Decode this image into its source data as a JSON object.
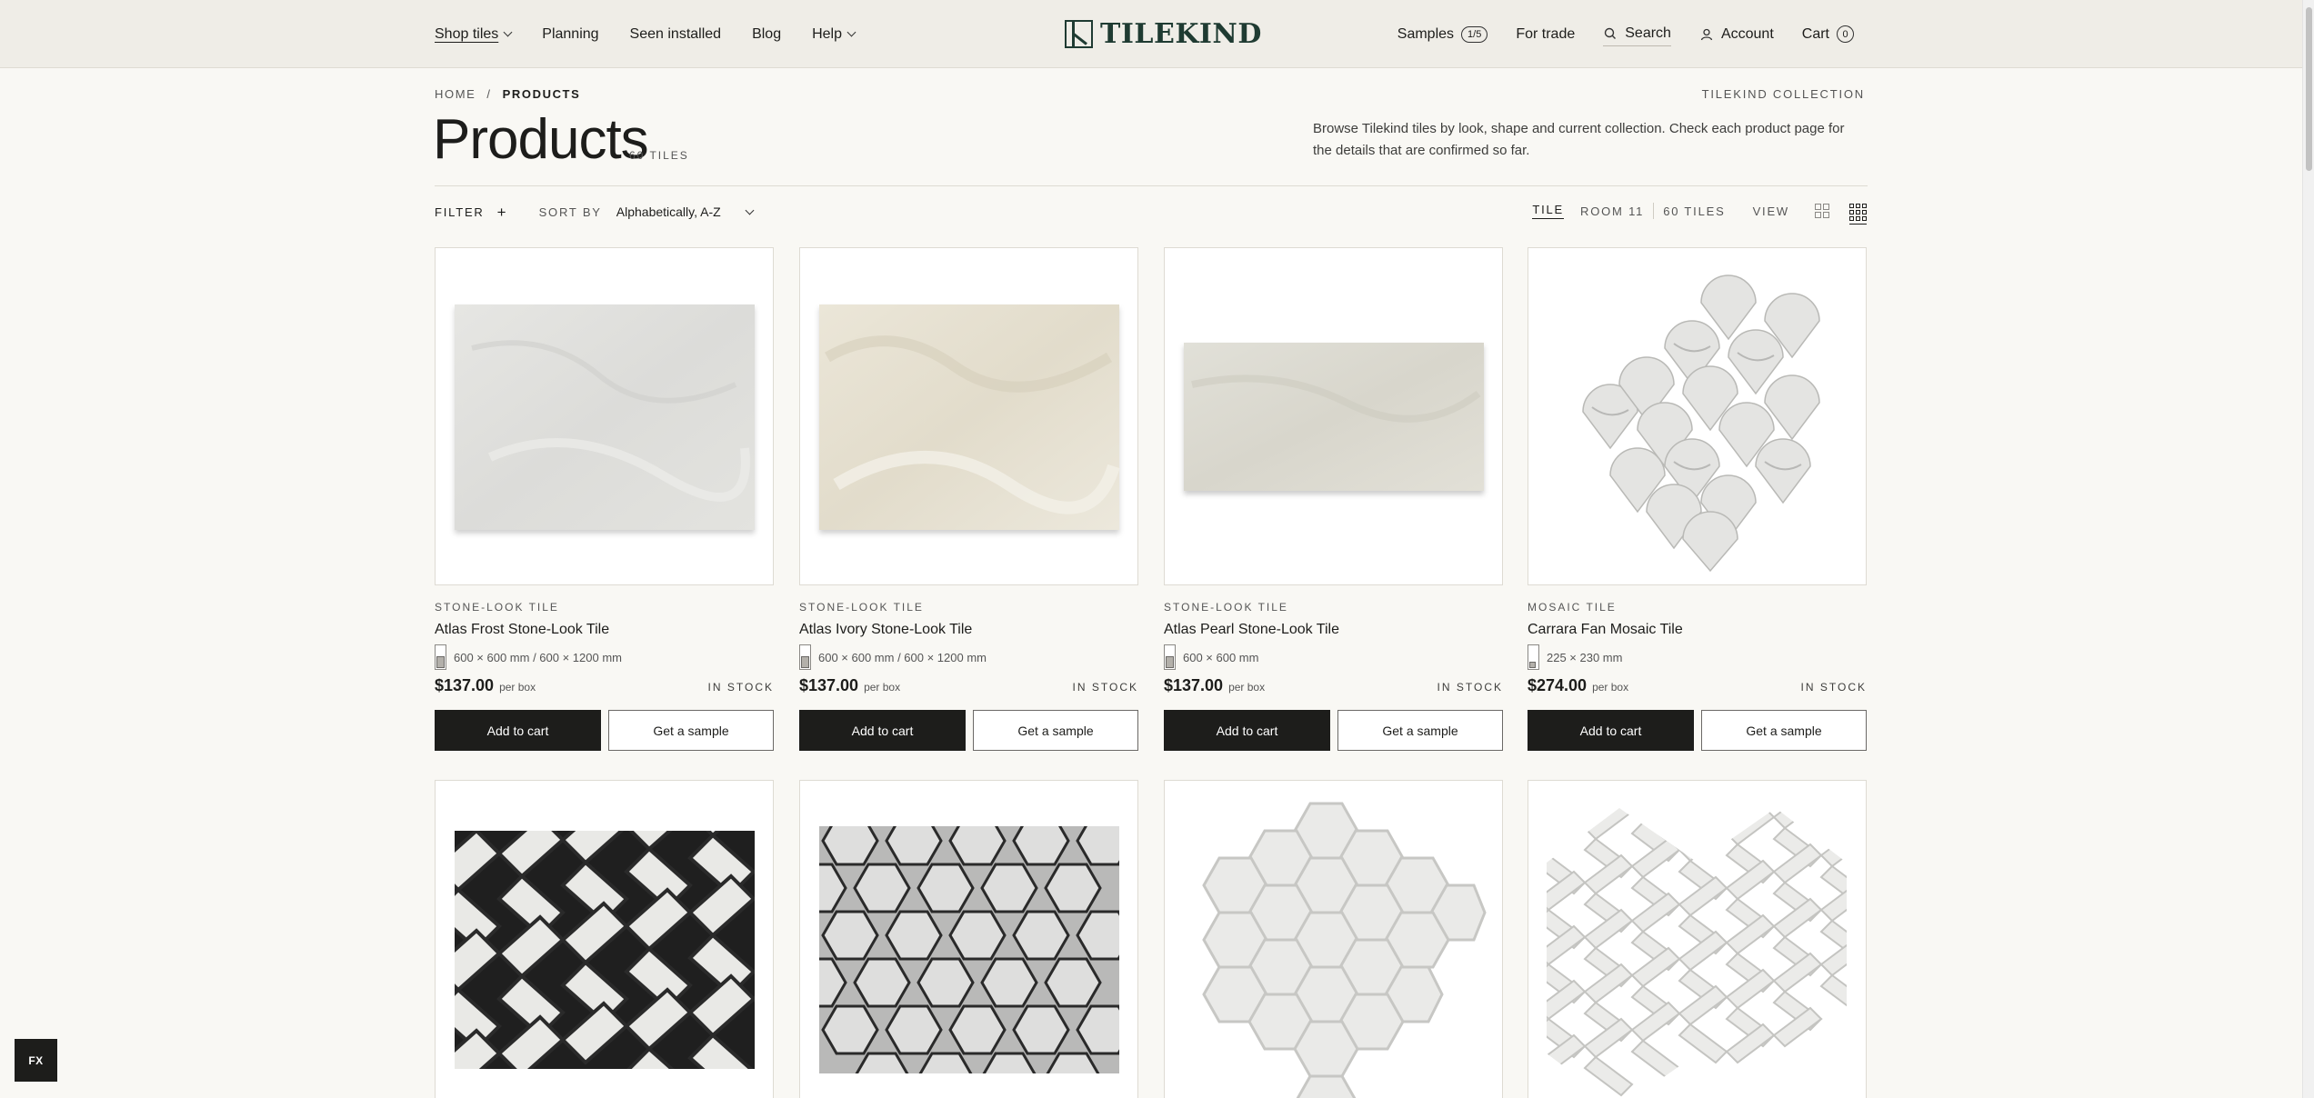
{
  "header": {
    "nav_left": [
      {
        "label": "Shop tiles",
        "dropdown": true
      },
      {
        "label": "Planning"
      },
      {
        "label": "Seen installed"
      },
      {
        "label": "Blog"
      },
      {
        "label": "Help",
        "dropdown": true
      }
    ],
    "logo_text": "TILEKIND",
    "samples_label": "Samples",
    "samples_count": "1/5",
    "trade_label": "For trade",
    "search_label": "Search",
    "account_label": "Account",
    "cart_label": "Cart",
    "cart_count": "0"
  },
  "breadcrumb": {
    "home": "HOME",
    "separator": "/",
    "current": "PRODUCTS"
  },
  "collection_label": "TILEKIND COLLECTION",
  "page": {
    "title": "Products",
    "count": "60 TILES",
    "intro": "Browse Tilekind tiles by look, shape and current collection. Check each product page for the details that are confirmed so far."
  },
  "toolbar": {
    "filter_label": "FILTER",
    "filter_plus": "+",
    "sort_by_label": "SORT BY",
    "sort_value": "Alphabetically, A-Z",
    "seg_tile": "TILE",
    "seg_room": "ROOM 11",
    "tiles_count": "60 TILES",
    "view_label": "VIEW"
  },
  "products": [
    {
      "category": "STONE-LOOK TILE",
      "name": "Atlas Frost Stone-Look Tile",
      "sizes": "600 × 600 mm / 600 × 1200 mm",
      "price": "$137.00",
      "per": "per box",
      "stock": "IN STOCK",
      "add_label": "Add to cart",
      "sample_label": "Get a sample"
    },
    {
      "category": "STONE-LOOK TILE",
      "name": "Atlas Ivory Stone-Look Tile",
      "sizes": "600 × 600 mm / 600 × 1200 mm",
      "price": "$137.00",
      "per": "per box",
      "stock": "IN STOCK",
      "add_label": "Add to cart",
      "sample_label": "Get a sample"
    },
    {
      "category": "STONE-LOOK TILE",
      "name": "Atlas Pearl Stone-Look Tile",
      "sizes": "600 × 600 mm",
      "price": "$137.00",
      "per": "per box",
      "stock": "IN STOCK",
      "add_label": "Add to cart",
      "sample_label": "Get a sample"
    },
    {
      "category": "MOSAIC TILE",
      "name": "Carrara Fan Mosaic Tile",
      "sizes": "225 × 230 mm",
      "price": "$274.00",
      "per": "per box",
      "stock": "IN STOCK",
      "add_label": "Add to cart",
      "sample_label": "Get a sample"
    }
  ],
  "fx_badge": "FX",
  "colors": {
    "accent": "#1f3b32",
    "header_bg": "#efede7",
    "page_bg": "#f9f8f4",
    "button_dark": "#1d1d1b"
  }
}
